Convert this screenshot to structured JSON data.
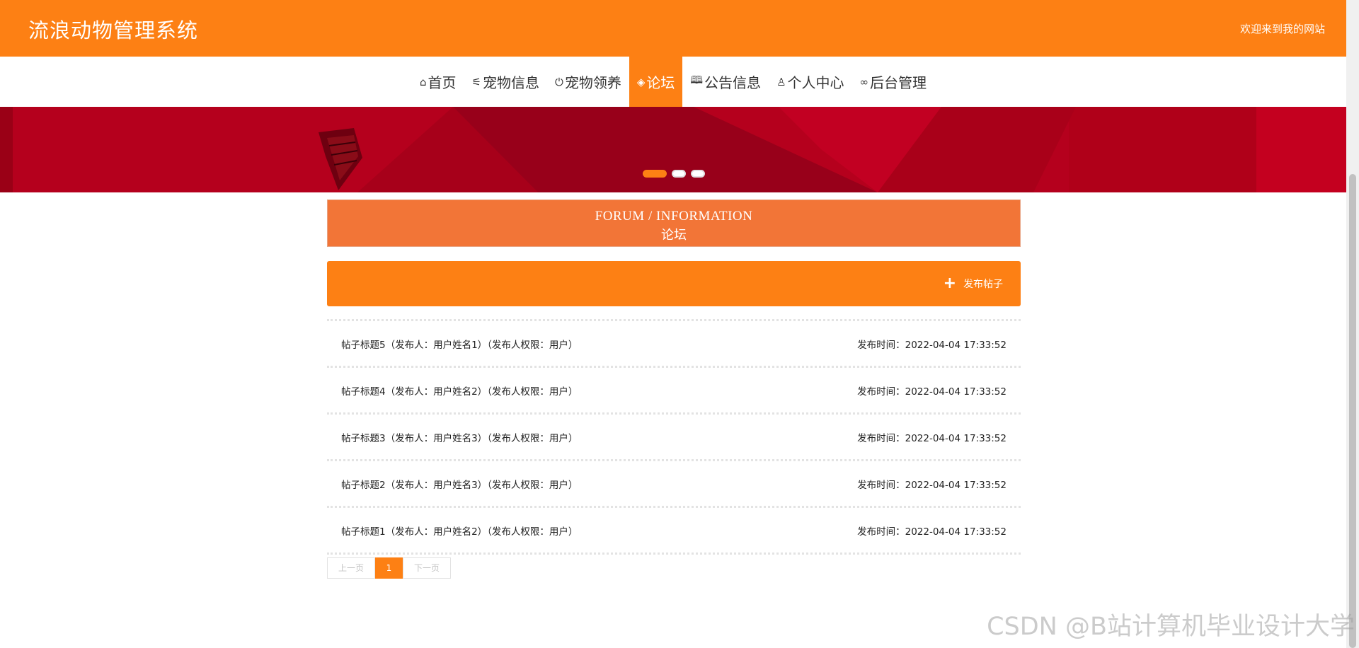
{
  "header": {
    "site_title": "流浪动物管理系统",
    "welcome": "欢迎来到我的网站"
  },
  "nav": {
    "items": [
      {
        "label": "首页",
        "icon": "home-icon",
        "glyph": "⌂"
      },
      {
        "label": "宠物信息",
        "icon": "sliders-icon",
        "glyph": "⚟"
      },
      {
        "label": "宠物领养",
        "icon": "power-icon",
        "glyph": "⏻"
      },
      {
        "label": "论坛",
        "icon": "graduation-cap-icon",
        "glyph": "◈"
      },
      {
        "label": "公告信息",
        "icon": "book-icon",
        "glyph": "🕮"
      },
      {
        "label": "个人中心",
        "icon": "user-icon",
        "glyph": "♙"
      },
      {
        "label": "后台管理",
        "icon": "link-icon",
        "glyph": "∞"
      }
    ],
    "active_index": 3
  },
  "banner": {
    "slide_count": 3,
    "active_slide": 0
  },
  "section": {
    "title_en": "FORUM / INFORMATION",
    "title_cn": "论坛"
  },
  "actions": {
    "publish_icon": "plus-icon",
    "publish_glyph": "+",
    "publish_label": "发布帖子"
  },
  "posts": [
    {
      "title": "帖子标题5（发布人：用户姓名1）（发布人权限：用户）",
      "time": "发布时间：2022-04-04 17:33:52"
    },
    {
      "title": "帖子标题4（发布人：用户姓名2）（发布人权限：用户）",
      "time": "发布时间：2022-04-04 17:33:52"
    },
    {
      "title": "帖子标题3（发布人：用户姓名3）（发布人权限：用户）",
      "time": "发布时间：2022-04-04 17:33:52"
    },
    {
      "title": "帖子标题2（发布人：用户姓名3）（发布人权限：用户）",
      "time": "发布时间：2022-04-04 17:33:52"
    },
    {
      "title": "帖子标题1（发布人：用户姓名2）（发布人权限：用户）",
      "time": "发布时间：2022-04-04 17:33:52"
    }
  ],
  "pagination": {
    "prev_label": "上一页",
    "current_page": "1",
    "next_label": "下一页"
  },
  "watermark": "CSDN @B站计算机毕业设计大学",
  "colors": {
    "brand": "#FD8014",
    "section_title_bg": "#F27537",
    "banner_red": "#b4001c"
  }
}
